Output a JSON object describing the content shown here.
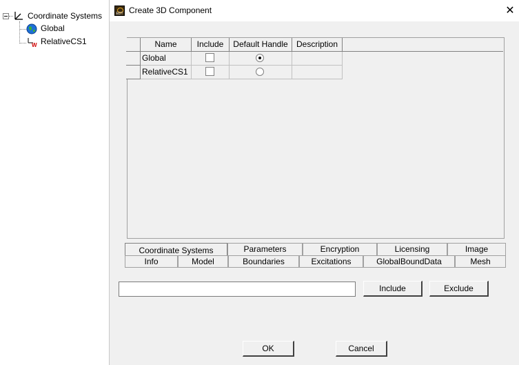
{
  "tree": {
    "root": {
      "label": "Coordinate Systems",
      "icon": "coordinate-axes-icon"
    },
    "children": [
      {
        "label": "Global",
        "icon": "globe-icon"
      },
      {
        "label": "RelativeCS1",
        "icon": "relative-cs-icon"
      }
    ]
  },
  "dialog": {
    "title": "Create 3D Component",
    "app_icon": "edt-app-icon",
    "close_glyph": "✕"
  },
  "grid": {
    "columns": [
      "Name",
      "Include",
      "Default Handle",
      "Description"
    ],
    "rows": [
      {
        "name": "Global",
        "include": false,
        "default_handle": true,
        "description": ""
      },
      {
        "name": "RelativeCS1",
        "include": false,
        "default_handle": false,
        "description": ""
      }
    ]
  },
  "tabs": {
    "row_top": [
      "Coordinate Systems",
      "Parameters",
      "Encryption",
      "Licensing",
      "Image"
    ],
    "row_bottom": [
      "Info",
      "Model",
      "Boundaries",
      "Excitations",
      "GlobalBoundData",
      "Mesh"
    ],
    "active": "Coordinate Systems"
  },
  "filter": {
    "value": "",
    "placeholder": ""
  },
  "buttons": {
    "include": "Include",
    "exclude": "Exclude",
    "ok": "OK",
    "cancel": "Cancel"
  }
}
